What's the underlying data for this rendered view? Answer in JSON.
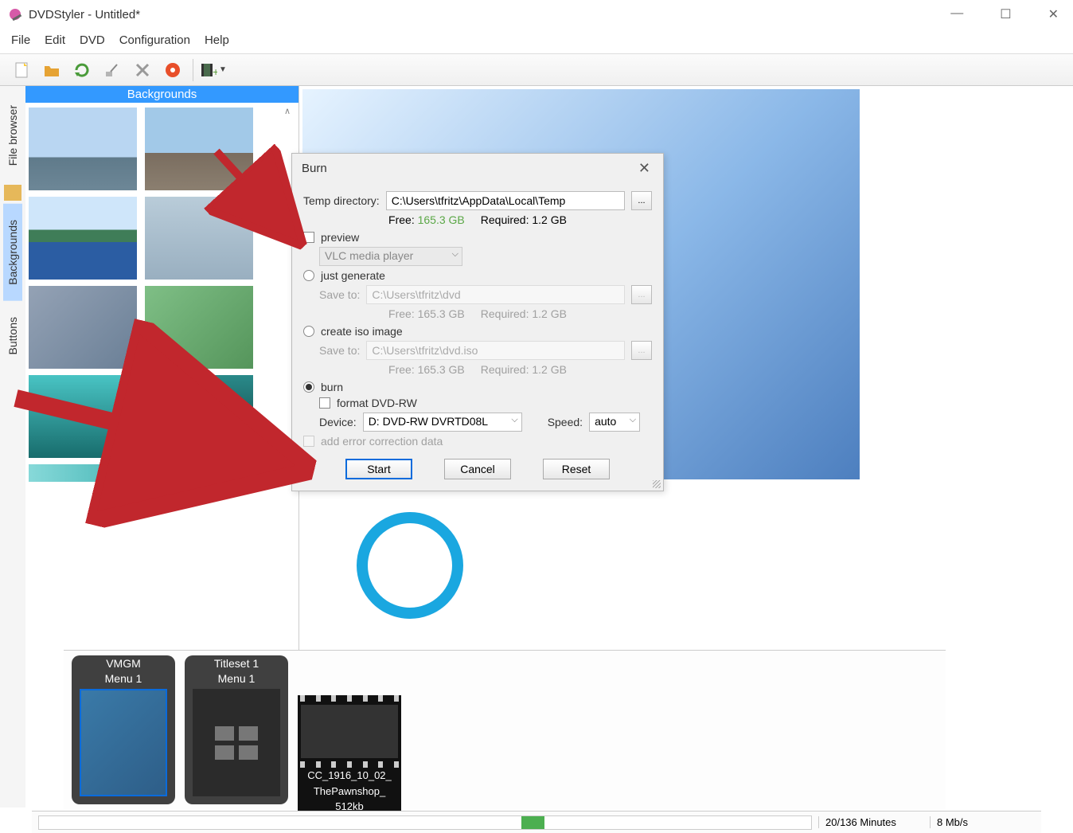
{
  "titlebar": {
    "title": "DVDStyler - Untitled*"
  },
  "menu": {
    "file": "File",
    "edit": "Edit",
    "dvd": "DVD",
    "config": "Configuration",
    "help": "Help"
  },
  "sidetabs": {
    "file_browser": "File browser",
    "backgrounds": "Backgrounds",
    "buttons": "Buttons"
  },
  "bgpanel": {
    "header": "Backgrounds"
  },
  "timeline": {
    "vmgm": {
      "title": "VMGM",
      "sub": "Menu 1"
    },
    "titleset": {
      "title": "Titleset 1",
      "sub": "Menu 1"
    },
    "clip": {
      "line1": "CC_1916_10_02_",
      "line2": "ThePawnshop_",
      "line3": "512kb"
    }
  },
  "status": {
    "minutes": "20/136 Minutes",
    "bitrate": "8 Mb/s"
  },
  "dialog": {
    "title": "Burn",
    "temp_label": "Temp directory:",
    "temp_value": "C:\\Users\\tfritz\\AppData\\Local\\Temp",
    "free_label": "Free:",
    "free_value": "165.3 GB",
    "required_label": "Required:",
    "required_value": "1.2 GB",
    "preview_label": "preview",
    "preview_player": "VLC media player",
    "generate_label": "just generate",
    "generate_saveto": "Save to:",
    "generate_path": "C:\\Users\\tfritz\\dvd",
    "generate_free": "Free: 165.3 GB",
    "generate_required": "Required: 1.2 GB",
    "iso_label": "create iso image",
    "iso_saveto": "Save to:",
    "iso_path": "C:\\Users\\tfritz\\dvd.iso",
    "iso_free": "Free: 165.3 GB",
    "iso_required": "Required: 1.2 GB",
    "burn_label": "burn",
    "format_label": "format DVD-RW",
    "device_label": "Device:",
    "device_value": "D: DVD-RW  DVRTD08L",
    "speed_label": "Speed:",
    "speed_value": "auto",
    "ecc_label": "add error correction data",
    "start": "Start",
    "cancel": "Cancel",
    "reset": "Reset"
  }
}
